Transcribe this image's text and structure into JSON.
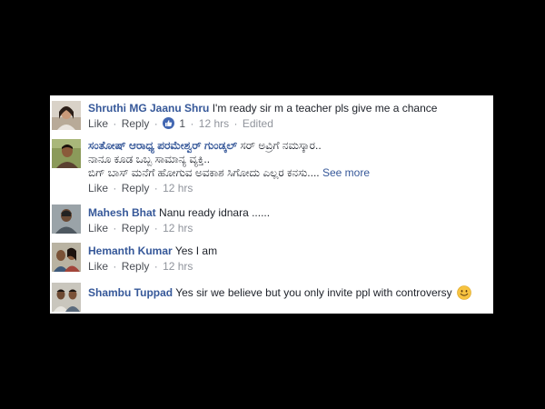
{
  "colors": {
    "background": "#000000",
    "panel": "#ffffff",
    "author": "#365899",
    "text": "#1d2129",
    "meta": "#90949c",
    "like_badge": "#4267b2",
    "emoji": "#f7c340"
  },
  "action_labels": {
    "like": "Like",
    "reply": "Reply",
    "separator": "·"
  },
  "comments": [
    {
      "author": "Shruthi MG Jaanu Shru",
      "lines": [
        "I'm ready sir m a teacher pls give me a chance"
      ],
      "like_count": "1",
      "time": "12 hrs",
      "edited": "Edited",
      "avatar_icon": "profile-photo"
    },
    {
      "author": "ಸಂತೋಷ್ ಆರಾಧ್ಯ ಪರಮೇಶ್ವರ್ ಗುಂಡ್ಕಲ್",
      "lines": [
        "ಸರ್ ಅವ್ರಿಗೆ ನಮಸ್ಕಾರ..",
        "ನಾನೂ ಕೂಡ ಒಬ್ಬ ಸಾಮಾನ್ಯ ವ್ಯಕ್ತಿ..",
        "ಬಿಗ್ ಬಾಸ್ ಮನೆಗೆ ಹೋಗುವ ಅವಕಾಶ ಸಿಗೋದು ಎಲ್ಲರ ಕನಸು...."
      ],
      "see_more": "See more",
      "time": "12 hrs",
      "avatar_icon": "profile-photo"
    },
    {
      "author": "Mahesh Bhat",
      "lines": [
        "Nanu ready idnara ......"
      ],
      "time": "12 hrs",
      "avatar_icon": "profile-photo"
    },
    {
      "author": "Hemanth Kumar",
      "lines": [
        "Yes I am"
      ],
      "time": "12 hrs",
      "avatar_icon": "profile-photo"
    },
    {
      "author": "Shambu Tuppad",
      "lines": [
        "Yes sir we believe but you only invite ppl with controversy"
      ],
      "emoji": "smiley-emoji",
      "avatar_icon": "profile-photo"
    }
  ]
}
